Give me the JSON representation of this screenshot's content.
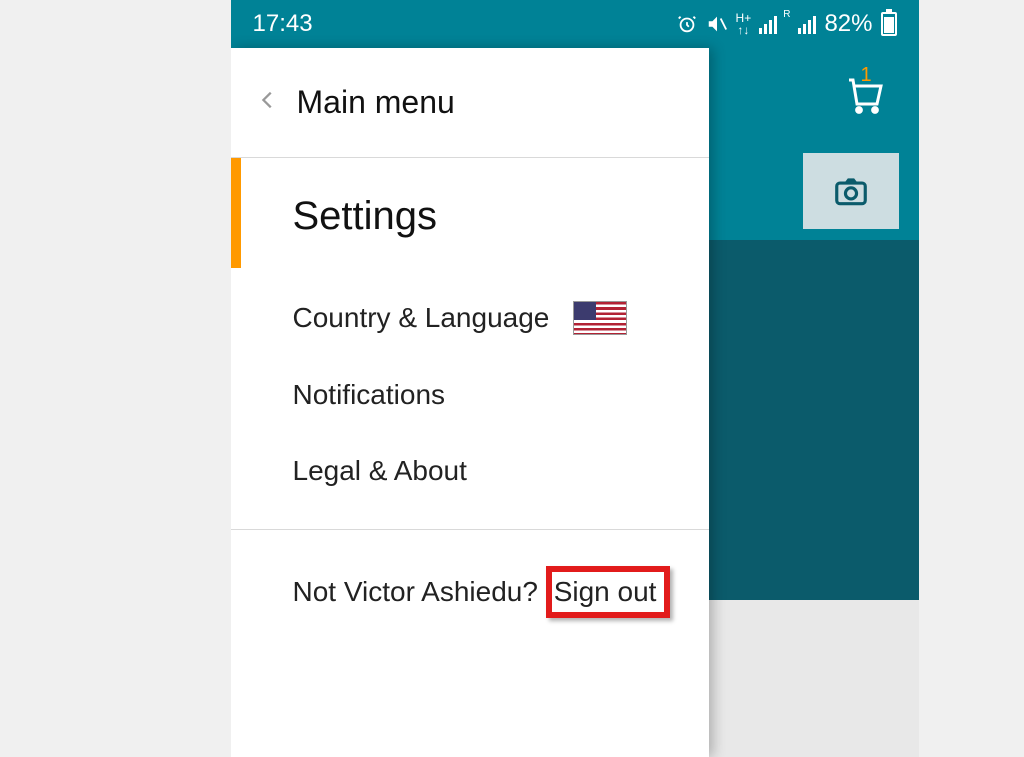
{
  "status_bar": {
    "time": "17:43",
    "battery_pct": "82%",
    "network_label_1": "H+",
    "network_label_2": "R"
  },
  "app": {
    "cart_count": "1"
  },
  "panel": {
    "back_label": "Main menu",
    "section": "Settings",
    "items": {
      "country_language": "Country & Language",
      "notifications": "Notifications",
      "legal_about": "Legal & About"
    },
    "signout_prefix": "Not Victor Ashiedu? ",
    "signout_action": "Sign out"
  }
}
